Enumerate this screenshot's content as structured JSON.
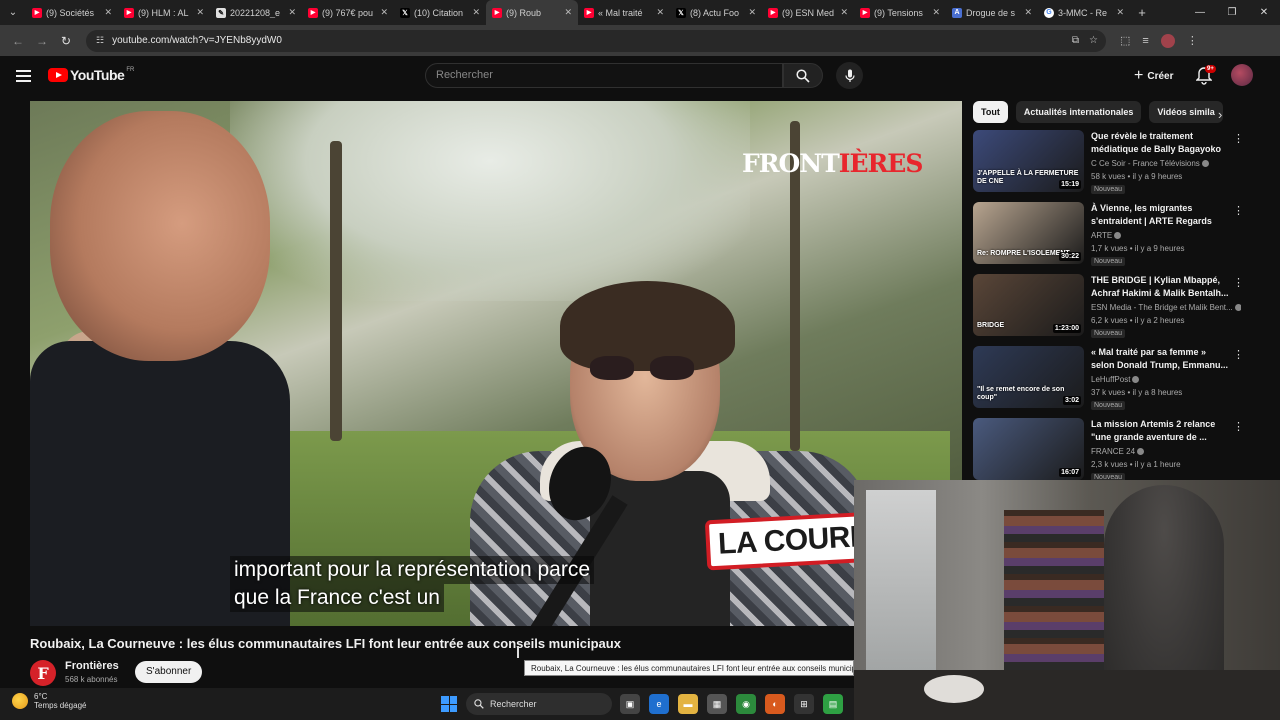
{
  "browser": {
    "tabs": [
      {
        "label": "(9) Sociétés",
        "icon": "youtube-icon",
        "color": "#ff0033"
      },
      {
        "label": "(9) HLM : AL",
        "icon": "youtube-icon",
        "color": "#ff0033"
      },
      {
        "label": "20221208_e",
        "icon": "feather-icon",
        "color": "#e0e0e0"
      },
      {
        "label": "(9) 767€ pou",
        "icon": "youtube-icon",
        "color": "#ff0033"
      },
      {
        "label": "(10) Citation",
        "icon": "x-icon",
        "color": "#000000"
      },
      {
        "label": "(9) Roub",
        "icon": "youtube-icon",
        "color": "#ff0033",
        "active": true
      },
      {
        "label": "« Mal traité",
        "icon": "youtube-icon",
        "color": "#ff0033"
      },
      {
        "label": "(8) Actu Foo",
        "icon": "x-icon",
        "color": "#000000"
      },
      {
        "label": "(9) ESN Med",
        "icon": "youtube-icon",
        "color": "#ff0033"
      },
      {
        "label": "(9) Tensions",
        "icon": "youtube-icon",
        "color": "#ff0033"
      },
      {
        "label": "Drogue de s",
        "icon": "globe-icon",
        "color": "#4a6fd1"
      },
      {
        "label": "3-MMC - Re",
        "icon": "google-icon",
        "color": "#ffffff"
      }
    ],
    "url": "youtube.com/watch?v=JYENb8yydW0"
  },
  "header": {
    "logo": "YouTube",
    "logo_region": "FR",
    "search_placeholder": "Rechercher",
    "create_label": "Créer",
    "notif_count": "9+"
  },
  "video": {
    "brand_logo_a": "FRONT",
    "brand_logo_b": "IÈRES",
    "sign_text": "LA COURN",
    "subtitle_line1": "important pour la représentation parce",
    "subtitle_line2": "que la France c'est un",
    "title": "Roubaix, La Courneuve : les élus communautaires LFI font leur entrée aux conseils municipaux",
    "tooltip": "Roubaix, La Courneuve : les élus communautaires LFI font leur entrée aux conseils municipaux"
  },
  "channel": {
    "avatar_letter": "F",
    "name": "Frontières",
    "subscribers": "568 k abonnés",
    "subscribe_label": "S'abonner"
  },
  "chips": [
    {
      "label": "Tout",
      "active": true
    },
    {
      "label": "Actualités internationales",
      "active": false
    },
    {
      "label": "Vidéos simila",
      "active": false
    }
  ],
  "recommendations": [
    {
      "title": "Que révèle le traitement médiatique de Bally Bagayoko ...",
      "channel": "C Ce Soir - France Télévisions",
      "meta": "58 k vues • il y a 9 heures",
      "badge": "Nouveau",
      "duration": "15:19",
      "thumb_text": "J'APPELLE À LA FERMETURE DE CNE",
      "thumb_color": "#3c4a7a"
    },
    {
      "title": "À Vienne, les migrantes s'entraident | ARTE Regards",
      "channel": "ARTE",
      "meta": "1,7 k vues • il y a 9 heures",
      "badge": "Nouveau",
      "duration": "30:22",
      "thumb_text": "Re: ROMPRE L'ISOLEMENT",
      "thumb_color": "#b8a590"
    },
    {
      "title": "THE BRIDGE | Kylian Mbappé, Achraf Hakimi & Malik Bentalh...",
      "channel": "ESN Media - The Bridge et Malik Bent...",
      "meta": "6,2 k vues • il y a 2 heures",
      "badge": "Nouveau",
      "duration": "1:23:00",
      "thumb_text": "BRIDGE",
      "thumb_color": "#5a4638"
    },
    {
      "title": "« Mal traité par sa femme » selon Donald Trump, Emmanu...",
      "channel": "LeHuffPost",
      "meta": "37 k vues • il y a 8 heures",
      "badge": "Nouveau",
      "duration": "3:02",
      "thumb_text": "\"Il se remet encore de son coup\"",
      "thumb_color": "#2e3a56"
    },
    {
      "title": "La mission Artemis 2 relance \"une grande aventure de ...",
      "channel": "FRANCE 24",
      "meta": "2,3 k vues • il y a 1 heure",
      "badge": "Nouveau",
      "duration": "16:07",
      "thumb_text": "",
      "thumb_color": "#4a5a7e"
    }
  ],
  "taskbar": {
    "temp": "6°C",
    "weather_desc": "Temps dégagé",
    "search_label": "Rechercher"
  }
}
